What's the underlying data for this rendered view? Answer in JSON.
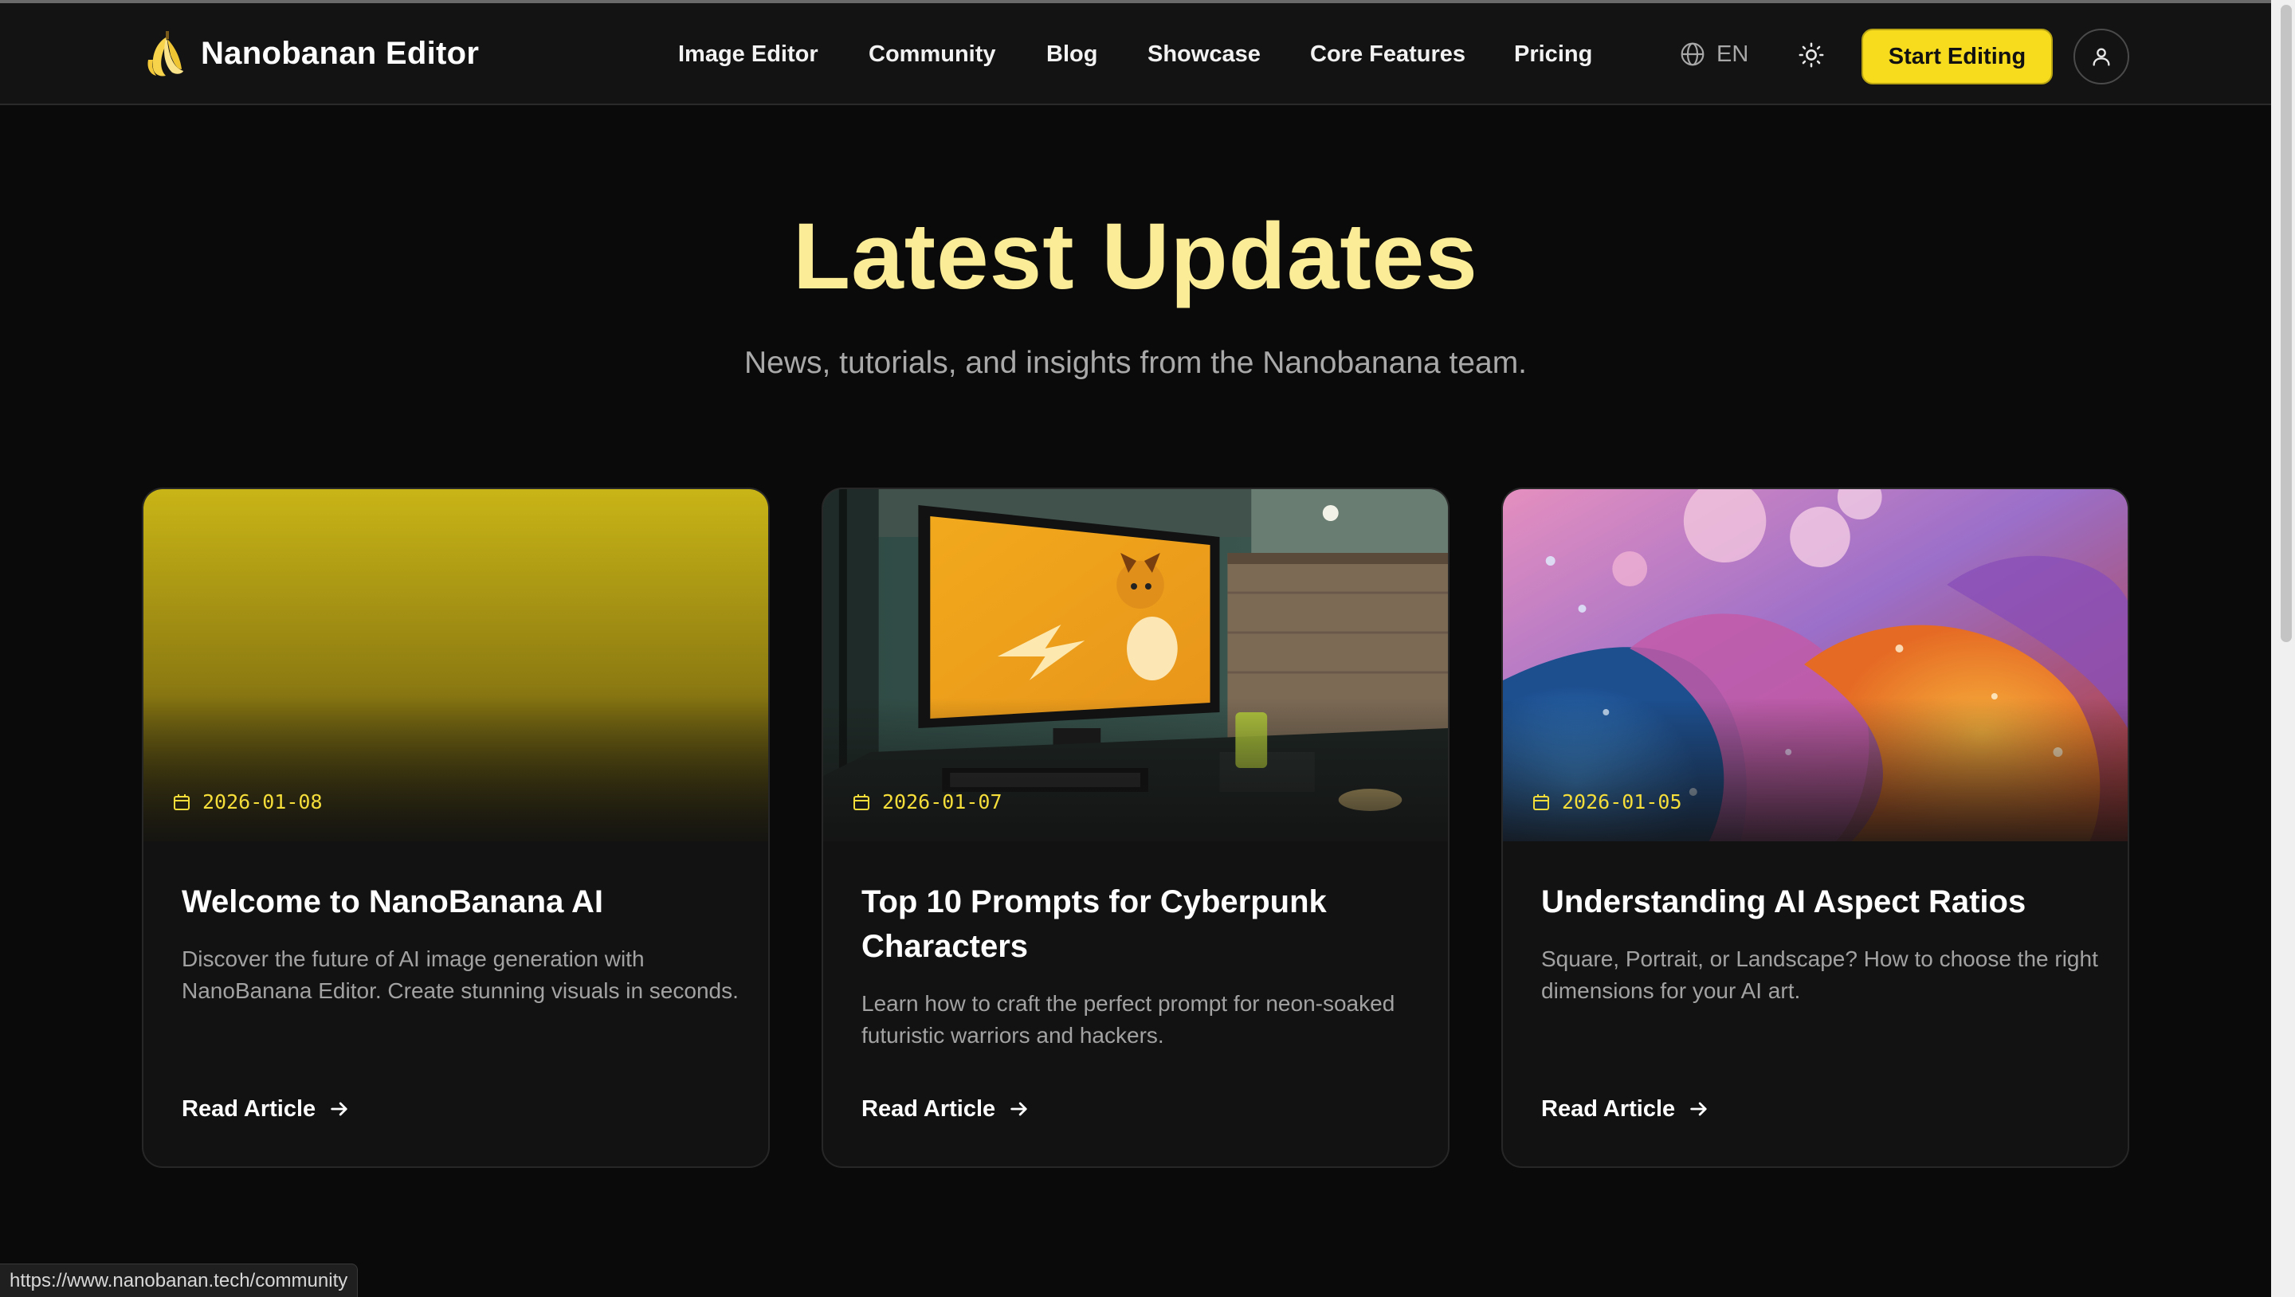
{
  "brand": {
    "name": "Nanobanan Editor",
    "icon": "banana-icon"
  },
  "nav": {
    "links": [
      "Image Editor",
      "Community",
      "Blog",
      "Showcase",
      "Core Features",
      "Pricing"
    ],
    "language": "EN",
    "language_icon": "globe-icon",
    "theme_icon": "sun-icon",
    "cta_label": "Start Editing",
    "user_icon": "user-icon"
  },
  "hero": {
    "title": "Latest Updates",
    "subtitle": "News, tutorials, and insights from the Nanobanana team."
  },
  "posts": [
    {
      "date": "2026-01-08",
      "title": "Welcome to NanoBanana AI",
      "description": "Discover the future of AI image generation with NanoBanana Editor. Create stunning visuals in seconds.",
      "link_label": "Read Article",
      "image": "yellow-gradient-cover"
    },
    {
      "date": "2026-01-07",
      "title": "Top 10 Prompts for Cyberpunk Characters",
      "description": "Learn how to craft the perfect prompt for neon-soaked futuristic warriors and hackers.",
      "link_label": "Read Article",
      "image": "desk-monitor-photo"
    },
    {
      "date": "2026-01-05",
      "title": "Understanding AI Aspect Ratios",
      "description": "Square, Portrait, or Landscape? How to choose the right dimensions for your AI art.",
      "link_label": "Read Article",
      "image": "colorful-bubbles-photo"
    }
  ],
  "status_bar": {
    "url": "https://www.nanobanan.tech/community"
  },
  "colors": {
    "accent": "#f7dc1e",
    "hero_title": "#fbec97",
    "background": "#0a0a0a",
    "card": "#121212"
  }
}
